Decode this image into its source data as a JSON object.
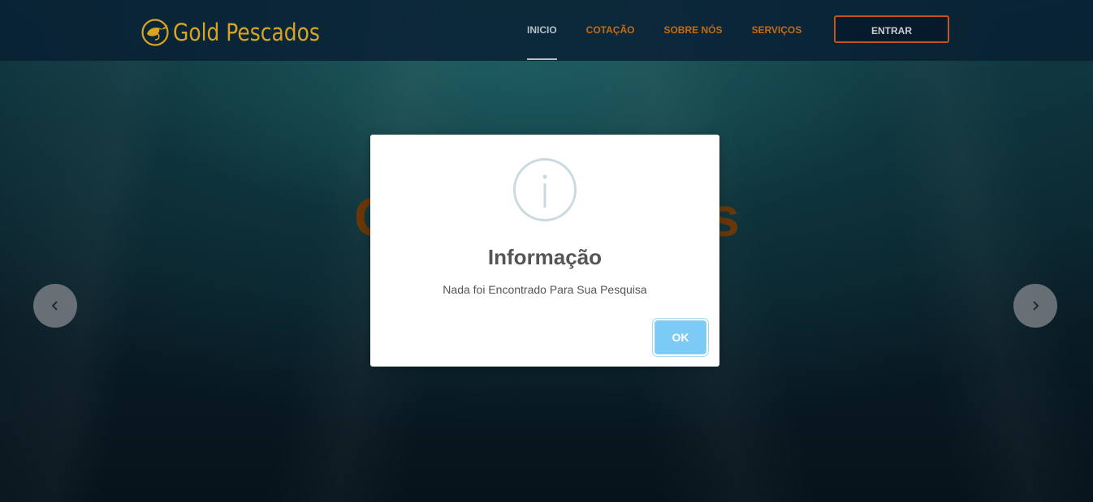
{
  "header": {
    "logo_text": "Gold Pescados",
    "nav": [
      {
        "label": "INICIO",
        "active": true
      },
      {
        "label": "COTAÇÃO",
        "active": false
      },
      {
        "label": "SOBRE NÓS",
        "active": false
      },
      {
        "label": "SERVIÇOS",
        "active": false
      }
    ],
    "login_label": "ENTRAR"
  },
  "hero": {
    "title_left_visible": "C",
    "title_right_visible": "s"
  },
  "carousel": {
    "prev_icon": "chevron-left-icon",
    "next_icon": "chevron-right-icon"
  },
  "dialog": {
    "icon": "info-icon",
    "title": "Informação",
    "message": "Nada foi Encontrado Para Sua Pesquisa",
    "ok_label": "OK"
  },
  "colors": {
    "brand_gold": "#d9a520",
    "nav_orange": "#c96a10",
    "login_border": "#c4541a",
    "ok_button": "#7ccbf6",
    "info_icon": "#c9dae1"
  }
}
